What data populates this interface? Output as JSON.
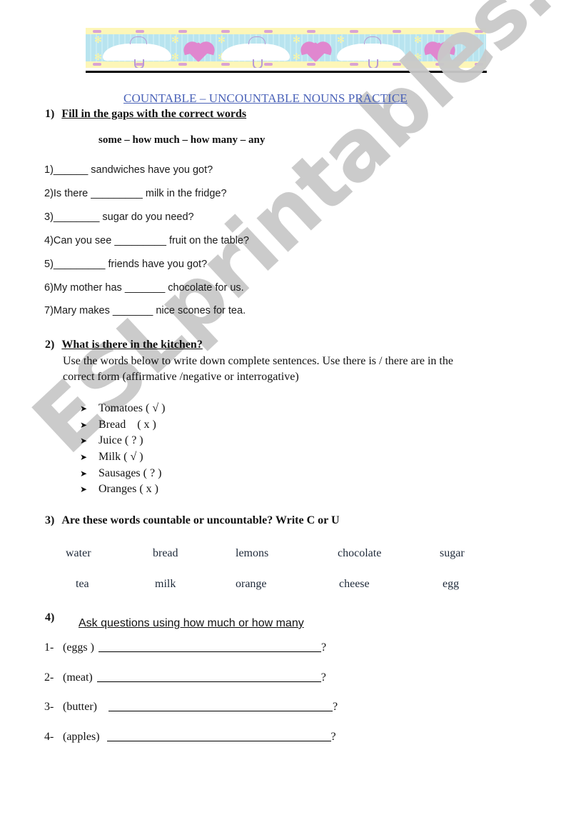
{
  "banner": {
    "decoration": "umbrella-and-heart-border",
    "colors": {
      "background": "#b8e4ef",
      "stripe": "#fdf6b8",
      "heart": "#e087cf",
      "umbrella": "#ffffff",
      "ribbon": "#b79ad6"
    }
  },
  "watermark": "ESLprintables.com",
  "title": "COUNTABLE – UNCOUNTABLE NOUNS PRACTICE",
  "title_color": "#4a62b8",
  "section1": {
    "number": "1)",
    "heading": "Fill in the gaps with the correct words",
    "word_bank": "some – how much – how many – any",
    "items": [
      "1)______ sandwiches have you got?",
      "2)Is there _________ milk in the fridge?",
      "3)________ sugar do you need?",
      "4)Can you see _________ fruit on the table?",
      "5)_________ friends have you got?",
      "6)My mother has _______ chocolate for us.",
      "7)Mary makes _______ nice scones for tea."
    ]
  },
  "section2": {
    "number": "2)",
    "heading": "What is there in the kitchen?",
    "instruction_line1": "Use the words below to write down complete sentences. Use there is / there are in the",
    "instruction_line2": "correct form (affirmative /negative or interrogative)",
    "bullet_icon": "arrowhead-bullet-icon",
    "items": [
      {
        "word": "Tomatoes",
        "mark": "( √ )"
      },
      {
        "word": "Bread",
        "mark": "( x )"
      },
      {
        "word": "Juice",
        "mark": "( ? )"
      },
      {
        "word": "Milk",
        "mark": "( √ )"
      },
      {
        "word": "Sausages",
        "mark": "( ? )"
      },
      {
        "word": "Oranges",
        "mark": "( x )"
      }
    ]
  },
  "section3": {
    "number": "3)",
    "heading": "Are these words countable or uncountable? Write C or U",
    "word_color": "#1f2a3a",
    "row1": [
      "water",
      "bread",
      "lemons",
      "chocolate",
      "sugar"
    ],
    "row2": [
      "tea",
      "milk",
      "orange",
      "cheese",
      "egg"
    ]
  },
  "section4": {
    "number": "4)",
    "heading": "Ask questions using how much or how many",
    "items": [
      {
        "num": "1-",
        "cue": "(eggs )",
        "end": "?"
      },
      {
        "num": "2-",
        "cue": "(meat)",
        "end": "?"
      },
      {
        "num": "3-",
        "cue": "(butter)",
        "end": "?"
      },
      {
        "num": "4-",
        "cue": "(apples)",
        "end": "?"
      }
    ]
  }
}
